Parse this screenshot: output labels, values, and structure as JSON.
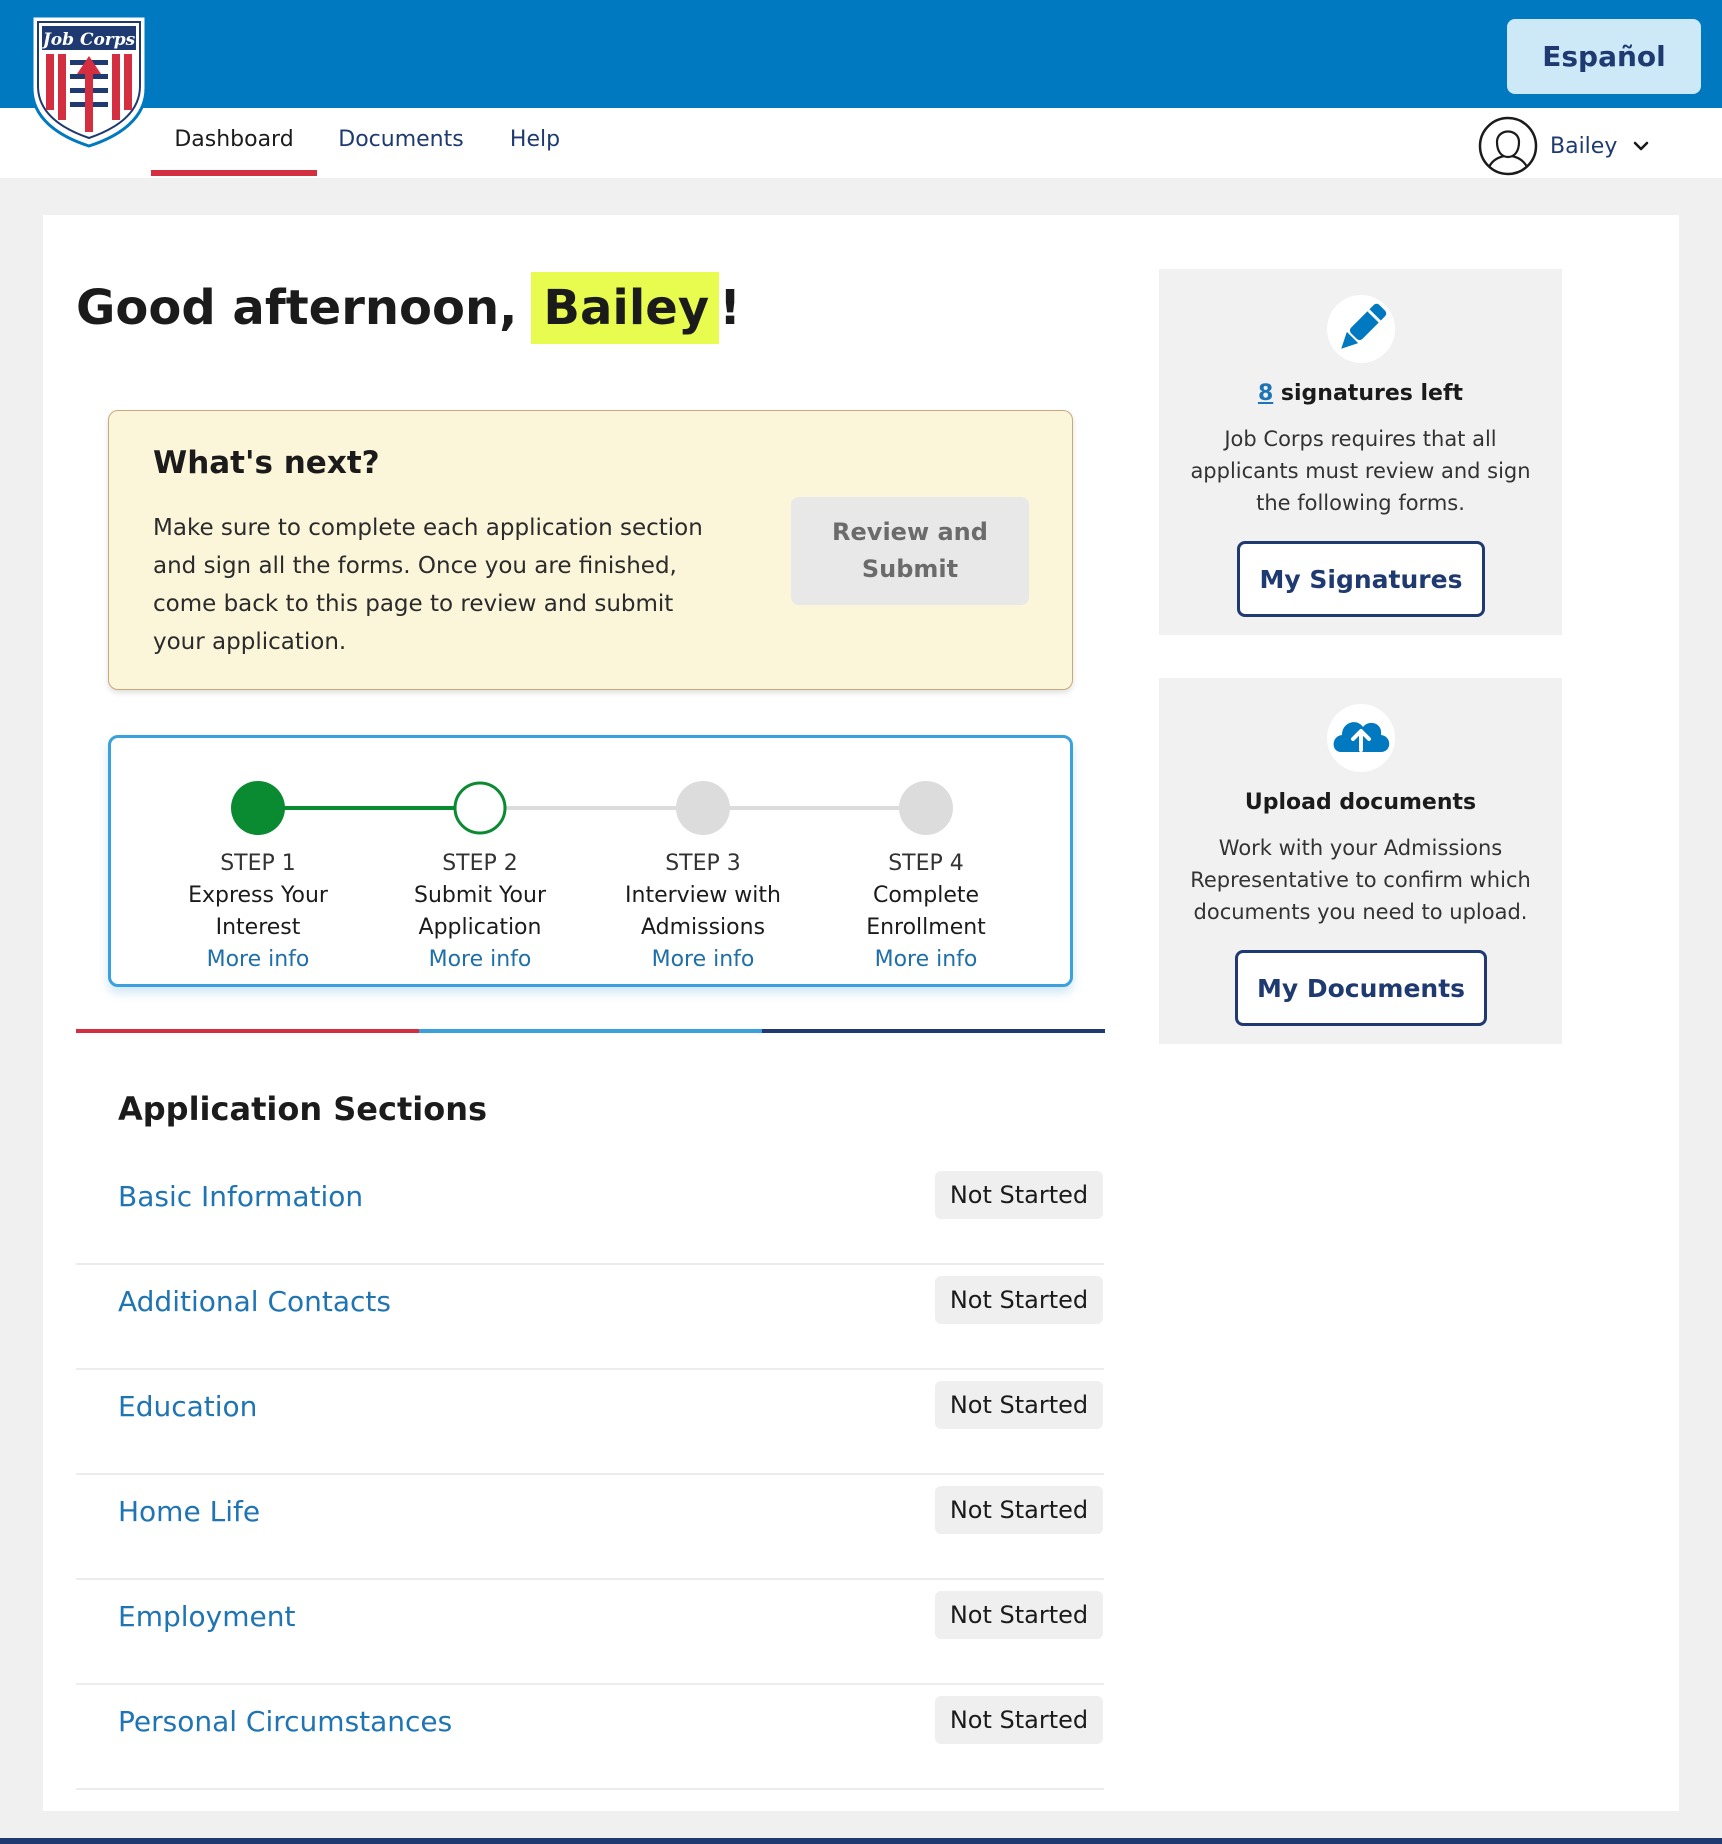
{
  "header": {
    "logo_text": "Job Corps",
    "language_button": "Español",
    "brand_color": "#0079c1",
    "accent_red": "#d42e41",
    "navy": "#1f3a70"
  },
  "nav": {
    "tabs": [
      {
        "label": "Dashboard",
        "active": true
      },
      {
        "label": "Documents",
        "active": false
      },
      {
        "label": "Help",
        "active": false
      }
    ],
    "user_name": "Bailey",
    "user_icons": {
      "avatar": "user-circle-icon",
      "menu": "chevron-down-icon"
    }
  },
  "greeting": {
    "prefix": "Good afternoon,",
    "name": "Bailey",
    "suffix": "!"
  },
  "whats_next": {
    "title": "What's next?",
    "body": "Make sure to complete each application section and sign all the forms. Once you are finished, come back to this page to review and submit your application.",
    "button": "Review and Submit"
  },
  "steps": [
    {
      "number": "STEP 1",
      "title": "Express Your Interest",
      "link": "More info",
      "status": "complete"
    },
    {
      "number": "STEP 2",
      "title": "Submit Your Application",
      "link": "More info",
      "status": "current"
    },
    {
      "number": "STEP 3",
      "title": "Interview with Admissions",
      "link": "More info",
      "status": "pending"
    },
    {
      "number": "STEP 4",
      "title": "Complete Enrollment",
      "link": "More info",
      "status": "pending"
    }
  ],
  "sections": {
    "title": "Application Sections",
    "rows": [
      {
        "name": "Basic Information",
        "status": "Not Started"
      },
      {
        "name": "Additional Contacts",
        "status": "Not Started"
      },
      {
        "name": "Education",
        "status": "Not Started"
      },
      {
        "name": "Home Life",
        "status": "Not Started"
      },
      {
        "name": "Employment",
        "status": "Not Started"
      },
      {
        "name": "Personal Circumstances",
        "status": "Not Started"
      }
    ]
  },
  "signatures_card": {
    "icon": "pen-icon",
    "count": "8",
    "title_suffix": " signatures left",
    "body": "Job Corps requires that all applicants must review and sign the following forms.",
    "button": "My Signatures"
  },
  "upload_card": {
    "icon": "cloud-upload-icon",
    "title": "Upload documents",
    "body": "Work with your Admissions Representative to confirm which documents you need to upload.",
    "button": "My Documents"
  }
}
